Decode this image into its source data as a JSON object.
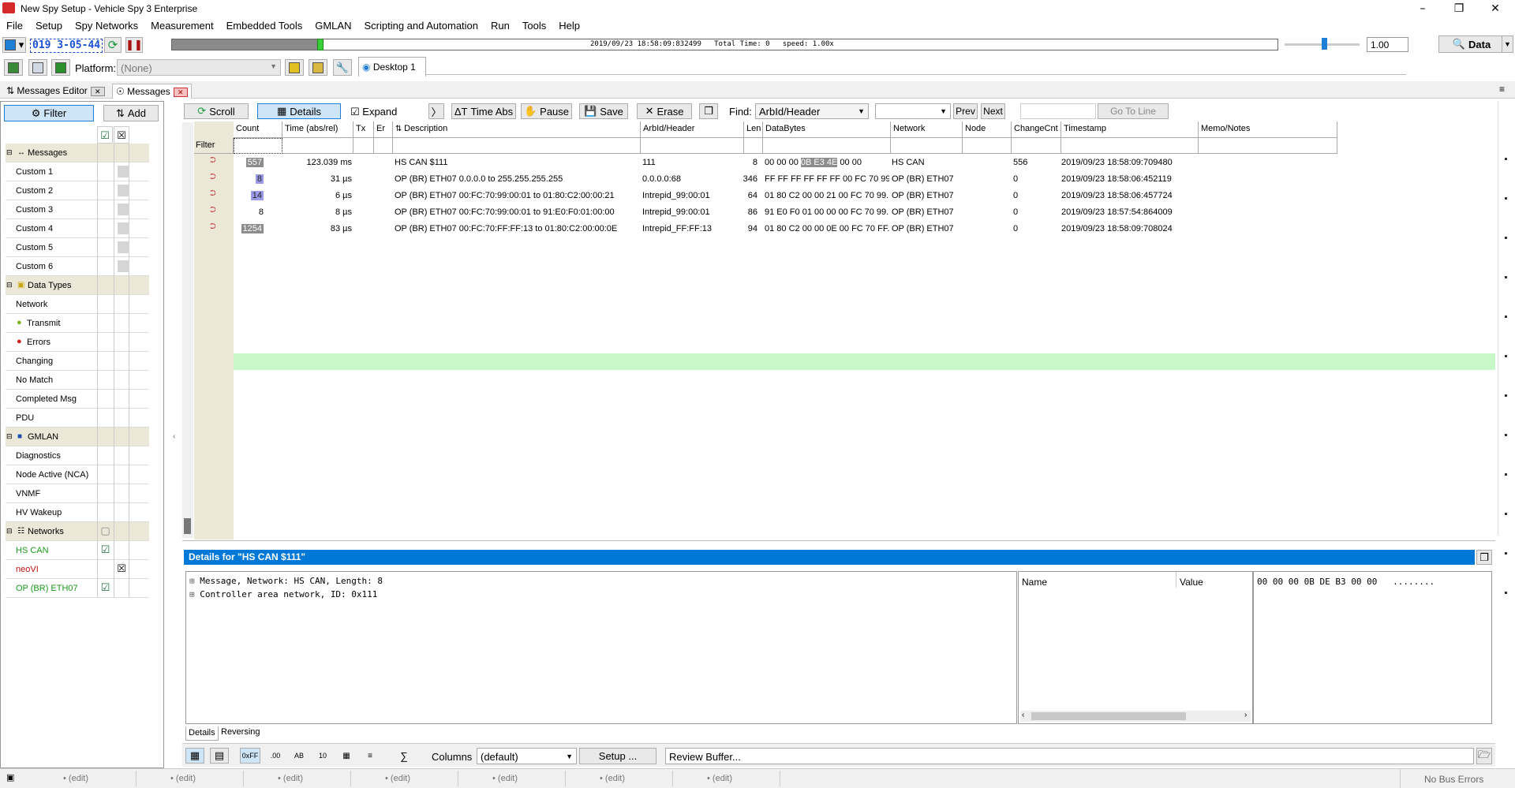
{
  "window": {
    "title": "New Spy Setup - Vehicle Spy 3 Enterprise"
  },
  "menu": [
    "File",
    "Setup",
    "Spy Networks",
    "Measurement",
    "Embedded Tools",
    "GMLAN",
    "Scripting and Automation",
    "Run",
    "Tools",
    "Help"
  ],
  "toolbar": {
    "config_id": "019 3-05-44",
    "timeline_text": "2019/09/23 18:58:09:832499   Total Time: 0   speed: 1.00x",
    "speed_value": "1.00",
    "data_button": "Data",
    "platform_label": "Platform:",
    "platform_value": "(None)",
    "desktop_tab": "Desktop 1"
  },
  "doc_tabs": {
    "messages_editor": "Messages Editor",
    "messages": "Messages"
  },
  "left_panel": {
    "filter_button": "Filter",
    "add_button": "Add",
    "rows": [
      {
        "label": "Messages",
        "header": true
      },
      {
        "label": "Custom 1"
      },
      {
        "label": "Custom 2"
      },
      {
        "label": "Custom 3"
      },
      {
        "label": "Custom 4"
      },
      {
        "label": "Custom 5"
      },
      {
        "label": "Custom 6"
      },
      {
        "label": "Data Types",
        "header": true
      },
      {
        "label": "Network"
      },
      {
        "label": "Transmit"
      },
      {
        "label": "Errors"
      },
      {
        "label": "Changing"
      },
      {
        "label": "No Match"
      },
      {
        "label": "Completed Msg"
      },
      {
        "label": "PDU"
      },
      {
        "label": "GMLAN",
        "header": true
      },
      {
        "label": "Diagnostics"
      },
      {
        "label": "Node Active (NCA)"
      },
      {
        "label": "VNMF"
      },
      {
        "label": "HV Wakeup"
      },
      {
        "label": "Networks",
        "header": true
      },
      {
        "label": "HS CAN"
      },
      {
        "label": "neoVI"
      },
      {
        "label": "OP (BR) ETH07"
      }
    ]
  },
  "msg_toolbar": {
    "scroll": "Scroll",
    "details": "Details",
    "expand": "Expand",
    "time_abs": "Time Abs",
    "pause": "Pause",
    "save": "Save",
    "erase": "Erase",
    "find_label": "Find:",
    "find_field": "ArbId/Header",
    "prev": "Prev",
    "next": "Next",
    "go_to_line": "Go To Line"
  },
  "grid": {
    "columns": [
      "Count",
      "Time (abs/rel)",
      "Tx",
      "Er",
      "Description",
      "ArbId/Header",
      "Len",
      "DataBytes",
      "Network",
      "Node",
      "ChangeCnt",
      "Timestamp",
      "Memo/Notes"
    ],
    "filter_label": "Filter",
    "rows": [
      {
        "count": "557",
        "time": "123.039 ms",
        "desc": "HS CAN $111",
        "arbid": "111",
        "len": "8",
        "data_pre": "00 00 00 ",
        "data_hl": "0B E3 4E",
        "data_post": " 00 00",
        "network": "HS CAN",
        "changecnt": "556",
        "timestamp": "2019/09/23 18:58:09:709480"
      },
      {
        "count": "8",
        "time": "31 µs",
        "desc": "OP (BR) ETH07 0.0.0.0 to 255.255.255.255",
        "arbid": "0.0.0.0:68",
        "len": "346",
        "data_pre": "FF FF FF FF FF FF 00 FC 70 99...",
        "data_hl": "",
        "data_post": "",
        "network": "OP (BR) ETH07",
        "changecnt": "0",
        "timestamp": "2019/09/23 18:58:06:452119"
      },
      {
        "count": "14",
        "time": "6 µs",
        "desc": "OP (BR) ETH07 00:FC:70:99:00:01 to 01:80:C2:00:00:21",
        "arbid": "Intrepid_99:00:01",
        "len": "64",
        "data_pre": "01 80 C2 00 00 21 00 FC 70 99...",
        "data_hl": "",
        "data_post": "",
        "network": "OP (BR) ETH07",
        "changecnt": "0",
        "timestamp": "2019/09/23 18:58:06:457724"
      },
      {
        "count": "8",
        "time": "8 µs",
        "desc": "OP (BR) ETH07 00:FC:70:99:00:01 to 91:E0:F0:01:00:00",
        "arbid": "Intrepid_99:00:01",
        "len": "86",
        "data_pre": "91 E0 F0 01 00 00 00 FC 70 99...",
        "data_hl": "",
        "data_post": "",
        "network": "OP (BR) ETH07",
        "changecnt": "0",
        "timestamp": "2019/09/23 18:57:54:864009"
      },
      {
        "count": "1254",
        "time": "83 µs",
        "desc": "OP (BR) ETH07 00:FC:70:FF:FF:13 to 01:80:C2:00:00:0E",
        "arbid": "Intrepid_FF:FF:13",
        "len": "94",
        "data_pre": "01 80 C2 00 00 0E 00 FC 70 FF...",
        "data_hl": "",
        "data_post": "",
        "network": "OP (BR) ETH07",
        "changecnt": "0",
        "timestamp": "2019/09/23 18:58:09:708024"
      }
    ]
  },
  "details": {
    "header": "Details for \"HS CAN $111\"",
    "tree": [
      "Message, Network: HS CAN, Length: 8",
      "Controller area network, ID: 0x111"
    ],
    "name_col": "Name",
    "value_col": "Value",
    "hex": "00 00 00 0B DE B3 00 00   ........",
    "tab_details": "Details",
    "tab_reversing": "Reversing",
    "columns_label": "Columns",
    "columns_value": "(default)",
    "setup_button": "Setup ...",
    "review_buffer": "Review Buffer..."
  },
  "status": {
    "edit": "(edit)",
    "bus_errors": "No Bus Errors"
  }
}
